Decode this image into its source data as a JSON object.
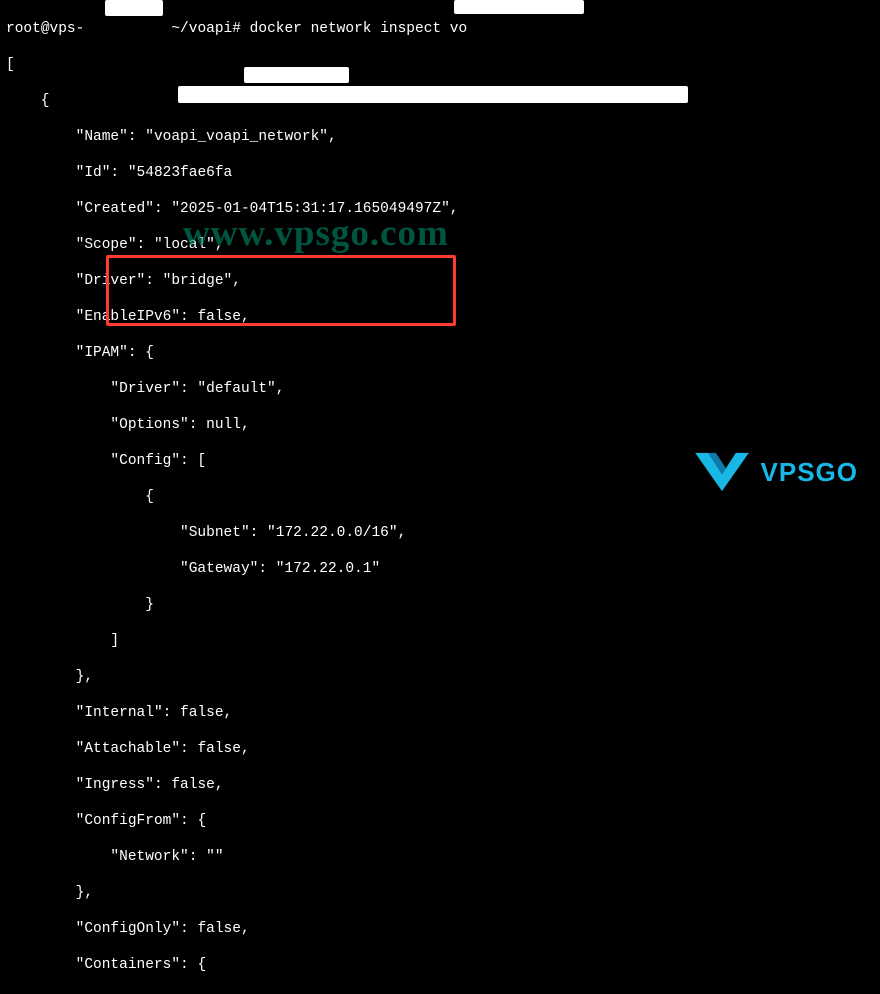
{
  "prompt": {
    "user": "root",
    "host": "vps-",
    "path": "~/voapi",
    "command": "docker network inspect vo"
  },
  "json": {
    "name_key": "\"Name\":",
    "name_val": "\"voapi_voapi_network\",",
    "id_key": "\"Id\":",
    "id_val": "\"54823fae6fa",
    "created_key": "\"Created\":",
    "created_val": "\"2025-01-04T15:31:17.165049497Z\",",
    "scope": "\"Scope\": \"local\",",
    "driver": "\"Driver\": \"bridge\",",
    "enableipv6": "\"EnableIPv6\": false,",
    "ipam_key": "\"IPAM\": {",
    "ipam_driver": "\"Driver\": \"default\",",
    "ipam_options": "\"Options\": null,",
    "ipam_config": "\"Config\": [",
    "subnet": "\"Subnet\": \"172.22.0.0/16\",",
    "gateway": "\"Gateway\": \"172.22.0.1\"",
    "internal": "\"Internal\": false,",
    "attachable": "\"Attachable\": false,",
    "ingress": "\"Ingress\": false,",
    "configfrom": "\"ConfigFrom\": {",
    "network": "\"Network\": \"\"",
    "configonly": "\"ConfigOnly\": false,",
    "containers": "\"Containers\": {"
  },
  "watermark_text": "www.vpsgo.com",
  "logo_text": "VPSGO"
}
